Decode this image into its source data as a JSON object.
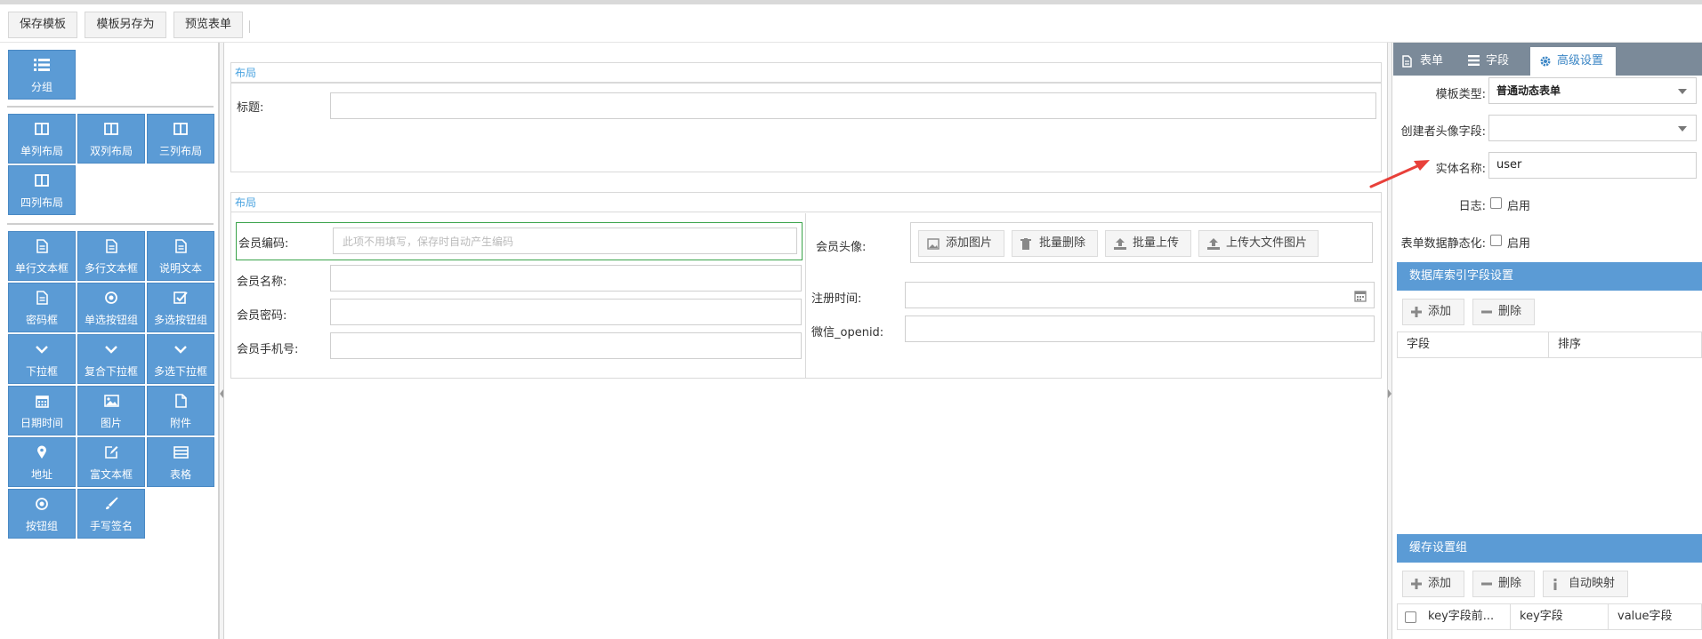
{
  "toolbar": {
    "save_template": "保存模板",
    "save_as": "模板另存为",
    "preview": "预览表单"
  },
  "palette": {
    "group": [
      "分组"
    ],
    "layouts": [
      "单列布局",
      "双列布局",
      "三列布局",
      "四列布局"
    ],
    "controls": [
      "单行文本框",
      "多行文本框",
      "说明文本",
      "密码框",
      "单选按钮组",
      "多选按钮组",
      "下拉框",
      "复合下拉框",
      "多选下拉框",
      "日期时间",
      "图片",
      "附件",
      "地址",
      "富文本框",
      "表格",
      "按钮组",
      "手写签名"
    ]
  },
  "canvas": {
    "block1": {
      "title": "布局",
      "field_label": "标题:"
    },
    "block2": {
      "title": "布局",
      "left_fields": [
        {
          "label": "会员编码:",
          "placeholder": "此项不用填写，保存时自动产生编码"
        },
        {
          "label": "会员名称:"
        },
        {
          "label": "会员密码:"
        },
        {
          "label": "会员手机号:"
        }
      ],
      "avatar_label": "会员头像:",
      "avatar_buttons": [
        "添加图片",
        "批量删除",
        "批量上传",
        "上传大文件图片"
      ],
      "reg_time_label": "注册时间:",
      "wechat_label": "微信_openid:"
    }
  },
  "panel": {
    "tabs": [
      "表单",
      "字段",
      "高级设置"
    ],
    "active_tab": "高级设置",
    "template_type_label": "模板类型:",
    "template_type_value": "普通动态表单",
    "creator_avatar_label": "创建者头像字段:",
    "creator_avatar_value": "",
    "entity_name_label": "实体名称:",
    "entity_name_value": "user",
    "log_label": "日志:",
    "log_option": "启用",
    "static_label": "表单数据静态化:",
    "static_option": "启用",
    "db_index_title": "数据库索引字段设置",
    "db_add": "添加",
    "db_delete": "删除",
    "db_columns": [
      "字段",
      "排序"
    ],
    "cache_title": "缓存设置组",
    "cache_add": "添加",
    "cache_delete": "删除",
    "cache_automap": "自动映射",
    "cache_columns": [
      "key字段前...",
      "key字段",
      "value字段"
    ]
  },
  "colors": {
    "palette_blue": "#5b9bd5",
    "tab_bar": "#7b8a99",
    "annotation_red": "#e8403a",
    "selected_green": "#3aa34a"
  }
}
